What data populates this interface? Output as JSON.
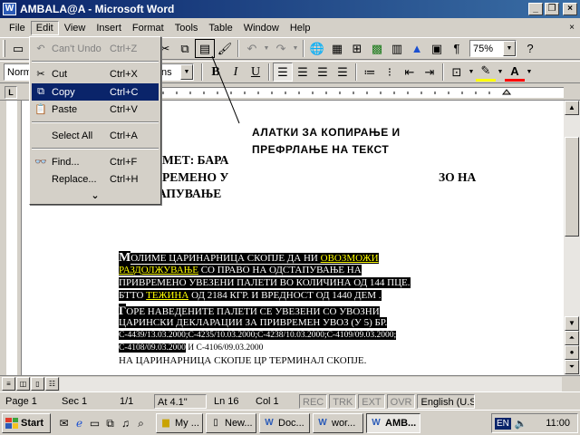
{
  "window": {
    "title": "AMBALA@A - Microsoft Word",
    "app_icon": "W",
    "controls": {
      "minimize": "_",
      "restore": "❐",
      "close": "×"
    }
  },
  "menubar": {
    "items": [
      {
        "label": "File"
      },
      {
        "label": "Edit"
      },
      {
        "label": "View"
      },
      {
        "label": "Insert"
      },
      {
        "label": "Format"
      },
      {
        "label": "Tools"
      },
      {
        "label": "Table"
      },
      {
        "label": "Window"
      },
      {
        "label": "Help"
      }
    ],
    "mdi_close": "×"
  },
  "toolbar": {
    "zoom": "75%",
    "style": "Norm",
    "font": "ns"
  },
  "edit_menu": {
    "items": [
      {
        "label": "Can't Undo",
        "shortcut": "Ctrl+Z",
        "icon": "undo-icon",
        "glyph": "↶"
      },
      {
        "label": "Cut",
        "shortcut": "Ctrl+X",
        "icon": "scissors-icon",
        "glyph": "✂"
      },
      {
        "label": "Copy",
        "shortcut": "Ctrl+C",
        "icon": "copy-icon",
        "glyph": "⧉"
      },
      {
        "label": "Paste",
        "shortcut": "Ctrl+V",
        "icon": "paste-icon",
        "glyph": "📋"
      },
      {
        "label": "Select All",
        "shortcut": "Ctrl+A",
        "icon": "",
        "glyph": ""
      },
      {
        "label": "Find...",
        "shortcut": "Ctrl+F",
        "icon": "binoculars-icon",
        "glyph": "👓"
      },
      {
        "label": "Replace...",
        "shortcut": "Ctrl+H",
        "icon": "",
        "glyph": ""
      }
    ],
    "more": "⌄"
  },
  "callout": {
    "line1": "АЛАТКИ ЗА КОПИРАЊЕ И",
    "line2": "ПРЕФРЛАЊЕ НА ТЕКСТ"
  },
  "document": {
    "heading": [
      "МЕТ: БАРА",
      "РЕМЕНО У",
      "ЗО НА",
      "АПУВАЊЕ"
    ],
    "p1": {
      "a": "М",
      "b": "ОЛИМЕ ЦАРИНАРНИЦА СКОПЈЕ ДА НИ ",
      "c": "ОВОЗМОЖИ",
      "d": "РАЗДОЛЖУВАЊЕ",
      "e": " СО ПРАВО НА ОДСТАПУВАЊЕ  НА",
      "f": "ПРИВРЕМЕНО УВЕЗЕНИ ПАЛЕТИ ВО КОЛИЧИНА ОД 144 ПЦЕ.",
      "g": "БТТО ",
      "h": "ТЕЖИНА",
      "i": " ОД 2184 КГР. И ВРЕДНОСТ ОД 1440 ДЕМ ."
    },
    "p2": {
      "a": " Г",
      "b": "ОРЕ НАВЕДЕНИТЕ ПАЛЕТИ СЕ  УВЕЗЕНИ СО УВОЗНИ",
      "c": "ЦАРИНСКИ ДЕКЛАРАЦИИ ЗА ПРИВРЕМЕН УВОЗ (У 5) БР.",
      "d": "С-4439/13.03.2000;С-4235/10.03.2000;С-4238/10.03.2000;С-4109/09.03.2000;",
      "e": "С-4108/09.03.2000",
      "f": " И С-4106/09.03.2000",
      "g": "НА ЦАРИНАРНИЦА СКОПЈЕ ЦР ТЕРМИНАЛ СКОПЈЕ."
    }
  },
  "statusbar": {
    "page": "Page  1",
    "sec": "Sec  1",
    "pages": "1/1",
    "at": "At  4.1\"",
    "ln": "Ln  16",
    "col": "Col  1",
    "rec": "REC",
    "trk": "TRK",
    "ext": "EXT",
    "ovr": "OVR",
    "lang": "English (U.S"
  },
  "taskbar": {
    "start": "Start",
    "tasks": [
      {
        "label": "My ...",
        "icon": "folder-icon"
      },
      {
        "label": "New...",
        "icon": "document-icon"
      },
      {
        "label": "Doc...",
        "icon": "word-icon"
      },
      {
        "label": "wor...",
        "icon": "word-icon"
      },
      {
        "label": "AMB...",
        "icon": "word-icon"
      }
    ],
    "lang": "EN",
    "clock": "11:00"
  },
  "colors": {
    "titlebar": "#0a246a",
    "selection": "#000000",
    "highlight_text": "#ffff00"
  }
}
